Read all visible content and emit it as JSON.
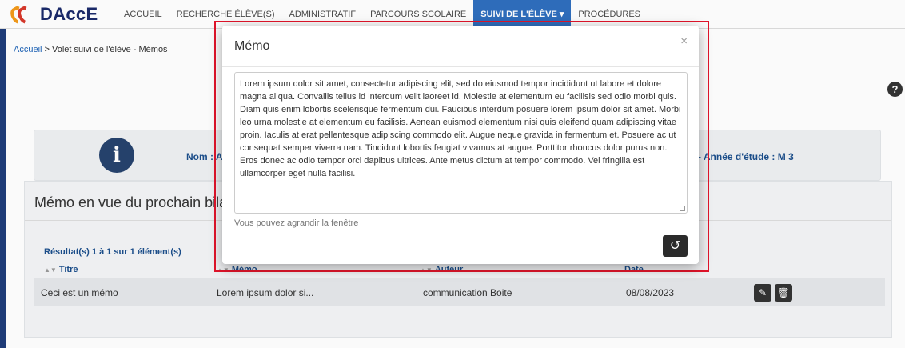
{
  "app": {
    "logo_text": "DAccE",
    "brand_colors": {
      "orange": "#f29a1a",
      "red": "#d8392b",
      "navy": "#1b2a6b",
      "nav_active": "#2f6fbe"
    }
  },
  "nav": {
    "items": [
      {
        "label": "ACCUEIL"
      },
      {
        "label": "RECHERCHE ÉLÈVE(S)"
      },
      {
        "label": "ADMINISTRATIF"
      },
      {
        "label": "PARCOURS SCOLAIRE"
      },
      {
        "label": "SUIVI DE L'ÉLÈVE ▾"
      },
      {
        "label": "PROCÉDURES"
      }
    ],
    "active_index": 4
  },
  "breadcrumb": {
    "home": "Accueil",
    "rest": " > Volet suivi de l'élève - Mémos"
  },
  "help_icon": "question-circle-icon",
  "info_panel": {
    "icon": "info-circle-icon",
    "nom_label": "Nom : A",
    "annee_label": "- Année d'étude : M 3"
  },
  "memo_section": {
    "title": "Mémo en vue du prochain bilan de",
    "results": "Résultat(s) 1 à 1 sur 1 élément(s)",
    "columns": [
      "Titre",
      "Mémo",
      "Auteur",
      "Date"
    ],
    "rows": [
      {
        "titre": "Ceci est un mémo",
        "memo": "Lorem ipsum dolor si...",
        "auteur": "communication  Boite",
        "date": "08/08/2023"
      }
    ],
    "row_actions": [
      "pencil-icon",
      "trash-icon"
    ]
  },
  "modal": {
    "title": "Mémo",
    "close_label": "×",
    "text": "Lorem ipsum dolor sit amet, consectetur adipiscing elit, sed do eiusmod tempor incididunt ut labore et dolore magna aliqua. Convallis tellus id interdum velit laoreet id. Molestie at elementum eu facilisis sed odio morbi quis. Diam quis enim lobortis scelerisque fermentum dui. Faucibus interdum posuere lorem ipsum dolor sit amet. Morbi leo urna molestie at elementum eu facilisis. Aenean euismod elementum nisi quis eleifend quam adipiscing vitae proin. Iaculis at erat pellentesque adipiscing commodo elit. Augue neque gravida in fermentum et. Posuere ac ut consequat semper viverra nam. Tincidunt lobortis feugiat vivamus at augue. Porttitor rhoncus dolor purus non. Eros donec ac odio tempor orci dapibus ultrices. Ante metus dictum at tempor commodo. Vel fringilla est ullamcorper eget nulla facilisi.",
    "helper": "Vous pouvez agrandir la fenêtre",
    "reset_icon": "undo-icon",
    "reset_glyph": "↺"
  }
}
